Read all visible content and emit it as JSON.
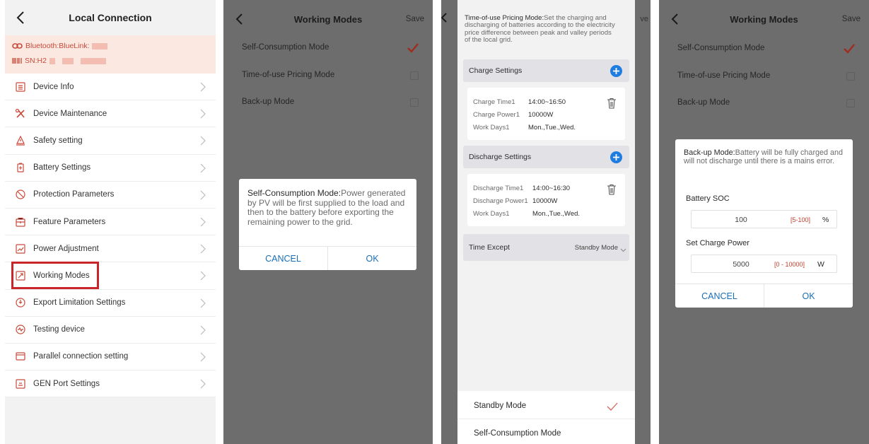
{
  "panel1": {
    "title": "Local Connection",
    "bluetooth_label": "Bluetooth:BlueLink:",
    "sn_label": "SN:H2",
    "menu": [
      {
        "label": "Device Info",
        "icon": "device-info-icon"
      },
      {
        "label": "Device Maintenance",
        "icon": "wrench-icon"
      },
      {
        "label": "Safety setting",
        "icon": "safety-icon"
      },
      {
        "label": "Battery Settings",
        "icon": "battery-icon"
      },
      {
        "label": "Protection Parameters",
        "icon": "protection-icon"
      },
      {
        "label": "Feature Parameters",
        "icon": "feature-icon"
      },
      {
        "label": "Power Adjustment",
        "icon": "power-adjust-icon"
      },
      {
        "label": "Working Modes",
        "icon": "working-modes-icon",
        "highlighted": true
      },
      {
        "label": "Export Limitation Settings",
        "icon": "export-limit-icon"
      },
      {
        "label": "Testing device",
        "icon": "testing-icon"
      },
      {
        "label": "Parallel connection setting",
        "icon": "parallel-icon"
      },
      {
        "label": "GEN Port Settings",
        "icon": "gen-port-icon"
      }
    ],
    "highlight_color": "#c8262a",
    "accent_color": "#c94a3a"
  },
  "panel2": {
    "title": "Working Modes",
    "save_label": "Save",
    "options": [
      {
        "label": "Self-Consumption Mode",
        "checked": true
      },
      {
        "label": "Time-of-use Pricing Mode",
        "checked": false
      },
      {
        "label": "Back-up Mode",
        "checked": false
      }
    ],
    "dialog": {
      "title": "Self-Consumption Mode:",
      "body": "Power generated by PV will be first supplied to the load and then to the battery before exporting the remaining power to the grid.",
      "cancel": "CANCEL",
      "ok": "OK"
    }
  },
  "panel3": {
    "save_label": "ve",
    "tou_title": "Time-of-use Pricing Mode:",
    "tou_body": "Set the charging and discharging of batteries according to the electricity price difference between peak and valley periods of the local grid.",
    "charge": {
      "section_label": "Charge Settings",
      "time_label": "Charge Time1",
      "time_value": "14:00~16:50",
      "power_label": "Charge Power1",
      "power_value": "10000W",
      "days_label": "Work Days1",
      "days_value": "Mon.,Tue.,Wed."
    },
    "discharge": {
      "section_label": "Discharge Settings",
      "time_label": "Discharge Time1",
      "time_value": "14:00~16:30",
      "power_label": "Discharge Power1",
      "power_value": "10000W",
      "days_label": "Work Days1",
      "days_value": "Mon.,Tue.,Wed."
    },
    "time_except": {
      "label": "Time Except",
      "value": "Standby Mode"
    },
    "picker": [
      {
        "label": "Standby Mode",
        "checked": true
      },
      {
        "label": "Self-Consumption Mode",
        "checked": false
      }
    ],
    "accent_color": "#1f7ce0"
  },
  "panel4": {
    "title": "Working Modes",
    "save_label": "Save",
    "options": [
      {
        "label": "Self-Consumption Mode",
        "checked": true
      },
      {
        "label": "Time-of-use Pricing Mode",
        "checked": false
      },
      {
        "label": "Back-up Mode",
        "checked": false
      }
    ],
    "dialog": {
      "title": "Back-up Mode:",
      "body": "Battery will be fully charged and will not discharge until there is a mains error.",
      "soc_label": "Battery SOC",
      "soc_value": "100",
      "soc_range": "[5-100]",
      "soc_unit": "%",
      "power_label": "Set Charge Power",
      "power_value": "5000",
      "power_range": "[0 - 10000]",
      "power_unit": "W",
      "cancel": "CANCEL",
      "ok": "OK"
    }
  }
}
